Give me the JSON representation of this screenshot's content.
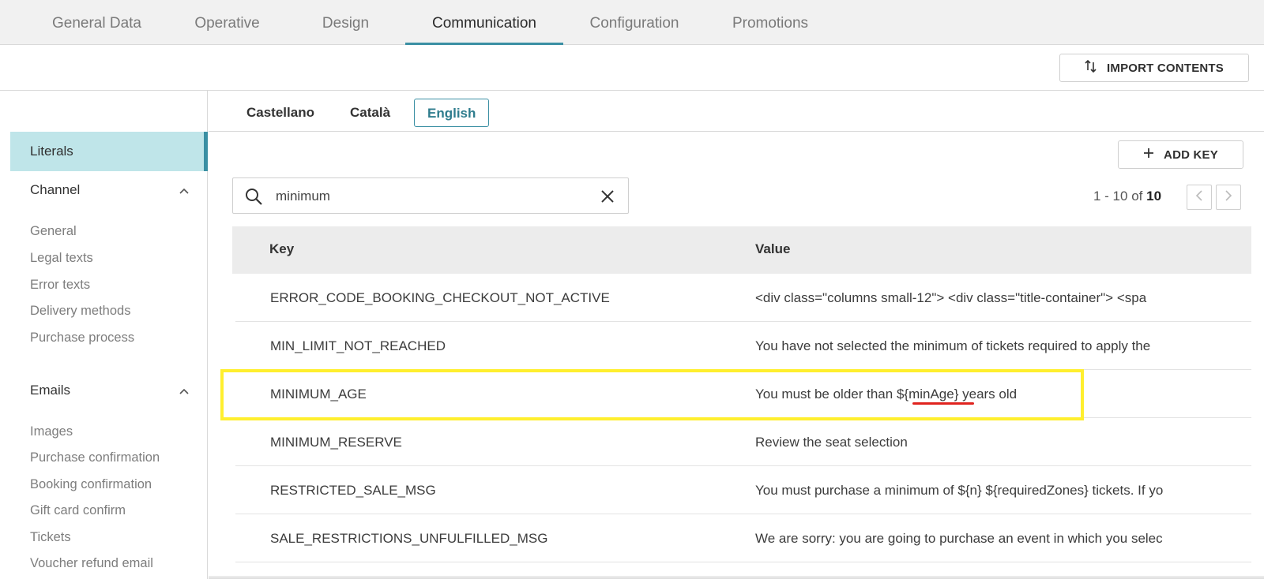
{
  "tabs": [
    {
      "label": "General Data",
      "active": false
    },
    {
      "label": "Operative",
      "active": false
    },
    {
      "label": "Design",
      "active": false
    },
    {
      "label": "Communication",
      "active": true
    },
    {
      "label": "Configuration",
      "active": false
    },
    {
      "label": "Promotions",
      "active": false
    }
  ],
  "toolbar": {
    "import_label": "IMPORT CONTENTS",
    "import_icon": "sort-arrows-icon"
  },
  "sidebar": {
    "active_item": "Literals",
    "channel": {
      "label": "Channel",
      "items": [
        "General",
        "Legal texts",
        "Error texts",
        "Delivery methods",
        "Purchase process"
      ]
    },
    "emails": {
      "label": "Emails",
      "items": [
        "Images",
        "Purchase confirmation",
        "Booking confirmation",
        "Gift card confirm",
        "Tickets",
        "Voucher refund email"
      ]
    }
  },
  "languages": [
    {
      "label": "Castellano",
      "active": false
    },
    {
      "label": "Català",
      "active": false
    },
    {
      "label": "English",
      "active": true
    }
  ],
  "add_key_label": "ADD KEY",
  "search": {
    "value": "minimum"
  },
  "pagination": {
    "range": "1 - 10",
    "of_label": "of",
    "total": "10"
  },
  "table": {
    "columns": [
      "Key",
      "Value"
    ],
    "rows": [
      {
        "key": "ERROR_CODE_BOOKING_CHECKOUT_NOT_ACTIVE",
        "value": "<div class=\"columns small-12\"> <div class=\"title-container\"> <spa"
      },
      {
        "key": "MIN_LIMIT_NOT_REACHED",
        "value": "You have not selected the minimum of tickets required to apply the"
      },
      {
        "key": "MINIMUM_AGE",
        "value": "You must be older than ${minAge} years old"
      },
      {
        "key": "MINIMUM_RESERVE",
        "value": "Review the seat selection"
      },
      {
        "key": "RESTRICTED_SALE_MSG",
        "value": "You must purchase a minimum of ${n} ${requiredZones} tickets. If yo"
      },
      {
        "key": "SALE_RESTRICTIONS_UNFULFILLED_MSG",
        "value": "We are sorry: you are going to purchase an event in which you selec"
      }
    ]
  },
  "colors": {
    "accent": "#3a8fa3",
    "active_bg": "#bfe5e9",
    "highlight": "#ffef2e",
    "underline": "#e0231e"
  }
}
